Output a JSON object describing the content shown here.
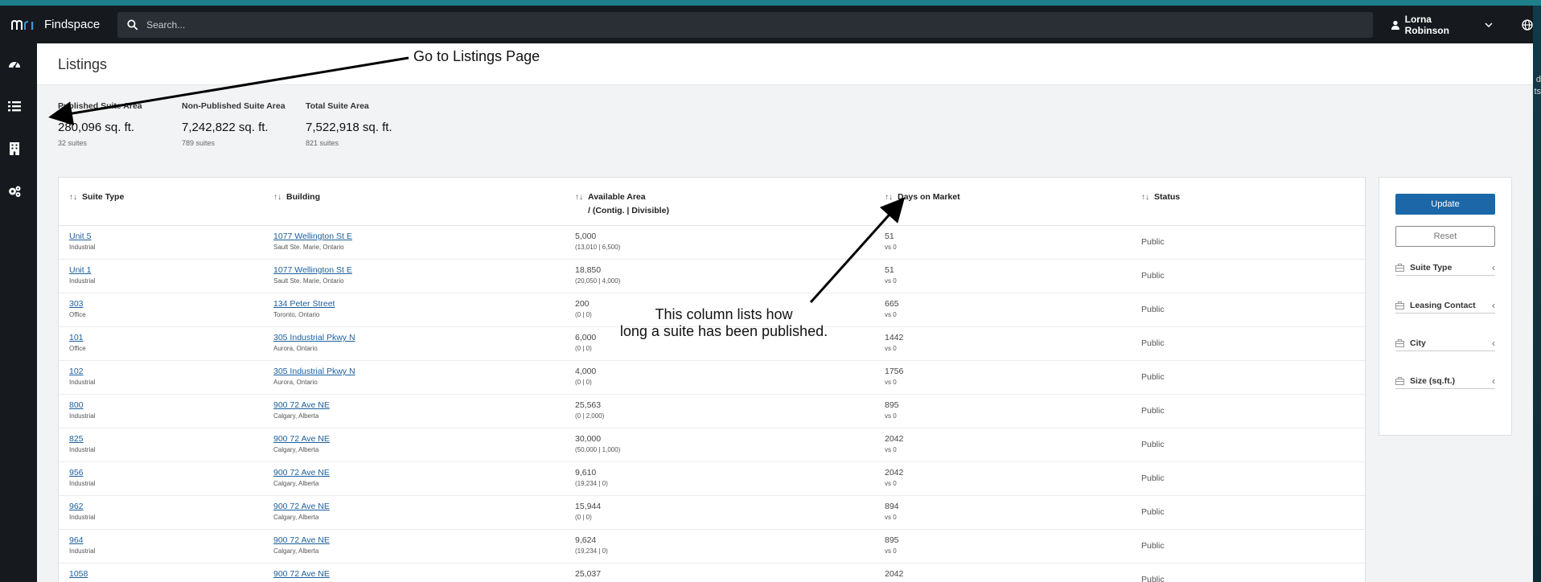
{
  "app": {
    "logo_text": "mri",
    "name": "Findspace"
  },
  "search": {
    "placeholder": "Search..."
  },
  "user": {
    "name": "Lorna Robinson"
  },
  "sidebar": {
    "items": [
      {
        "icon": "dashboard-icon"
      },
      {
        "icon": "list-icon"
      },
      {
        "icon": "building-icon"
      },
      {
        "icon": "settings-icon"
      }
    ]
  },
  "page": {
    "title": "Listings"
  },
  "stats": [
    {
      "label": "Published Suite Area",
      "value": "280,096 sq. ft.",
      "sub": "32 suites"
    },
    {
      "label": "Non-Published Suite Area",
      "value": "7,242,822 sq. ft.",
      "sub": "789 suites"
    },
    {
      "label": "Total Suite Area",
      "value": "7,522,918 sq. ft.",
      "sub": "821 suites"
    }
  ],
  "table": {
    "headers": {
      "suite_type": "Suite Type",
      "building": "Building",
      "available_area": "Available Area",
      "available_area_sub": "/ (Contig. | Divisible)",
      "days_on_market": "Days on Market",
      "status": "Status"
    },
    "rows": [
      {
        "suite": "Unit 5",
        "type": "Industrial",
        "building": "1077 Wellington St E",
        "city": "Sault Ste. Marie, Ontario",
        "area": "5,000",
        "area_sub": "(13,010 | 6,500)",
        "days": "51",
        "days_sub": "vs 0",
        "status": "Public"
      },
      {
        "suite": "Unit 1",
        "type": "Industrial",
        "building": "1077 Wellington St E",
        "city": "Sault Ste. Marie, Ontario",
        "area": "18,850",
        "area_sub": "(20,050 | 4,000)",
        "days": "51",
        "days_sub": "vs 0",
        "status": "Public"
      },
      {
        "suite": "303",
        "type": "Office",
        "building": "134 Peter Street",
        "city": "Toronto, Ontario",
        "area": "200",
        "area_sub": "(0 | 0)",
        "days": "665",
        "days_sub": "vs 0",
        "status": "Public"
      },
      {
        "suite": "101",
        "type": "Office",
        "building": "305 Industrial Pkwy N",
        "city": "Aurora, Ontario",
        "area": "6,000",
        "area_sub": "(0 | 0)",
        "days": "1442",
        "days_sub": "vs 0",
        "status": "Public"
      },
      {
        "suite": "102",
        "type": "Industrial",
        "building": "305 Industrial Pkwy N",
        "city": "Aurora, Ontario",
        "area": "4,000",
        "area_sub": "(0 | 0)",
        "days": "1756",
        "days_sub": "vs 0",
        "status": "Public"
      },
      {
        "suite": "800",
        "type": "Industrial",
        "building": "900 72 Ave NE",
        "city": "Calgary, Alberta",
        "area": "25,563",
        "area_sub": "(0 | 2,000)",
        "days": "895",
        "days_sub": "vs 0",
        "status": "Public"
      },
      {
        "suite": "825",
        "type": "Industrial",
        "building": "900 72 Ave NE",
        "city": "Calgary, Alberta",
        "area": "30,000",
        "area_sub": "(50,000 | 1,000)",
        "days": "2042",
        "days_sub": "vs 0",
        "status": "Public"
      },
      {
        "suite": "956",
        "type": "Industrial",
        "building": "900 72 Ave NE",
        "city": "Calgary, Alberta",
        "area": "9,610",
        "area_sub": "(19,234 | 0)",
        "days": "2042",
        "days_sub": "vs 0",
        "status": "Public"
      },
      {
        "suite": "962",
        "type": "Industrial",
        "building": "900 72 Ave NE",
        "city": "Calgary, Alberta",
        "area": "15,944",
        "area_sub": "(0 | 0)",
        "days": "894",
        "days_sub": "vs 0",
        "status": "Public"
      },
      {
        "suite": "964",
        "type": "Industrial",
        "building": "900 72 Ave NE",
        "city": "Calgary, Alberta",
        "area": "9,624",
        "area_sub": "(19,234 | 0)",
        "days": "895",
        "days_sub": "vs 0",
        "status": "Public"
      },
      {
        "suite": "1058",
        "type": "",
        "building": "900 72 Ave NE",
        "city": "",
        "area": "25,037",
        "area_sub": "",
        "days": "2042",
        "days_sub": "",
        "status": "Public"
      }
    ]
  },
  "filters": {
    "update_label": "Update",
    "reset_label": "Reset",
    "facets": [
      "Suite Type",
      "Leasing Contact",
      "City",
      "Size (sq.ft.)"
    ]
  },
  "annotations": {
    "listings_note": "Go to Listings  Page",
    "days_note_line1": "This column lists how",
    "days_note_line2": "long a suite has been published."
  },
  "edge_fragment": {
    "line1": "d",
    "line2": "ts"
  }
}
